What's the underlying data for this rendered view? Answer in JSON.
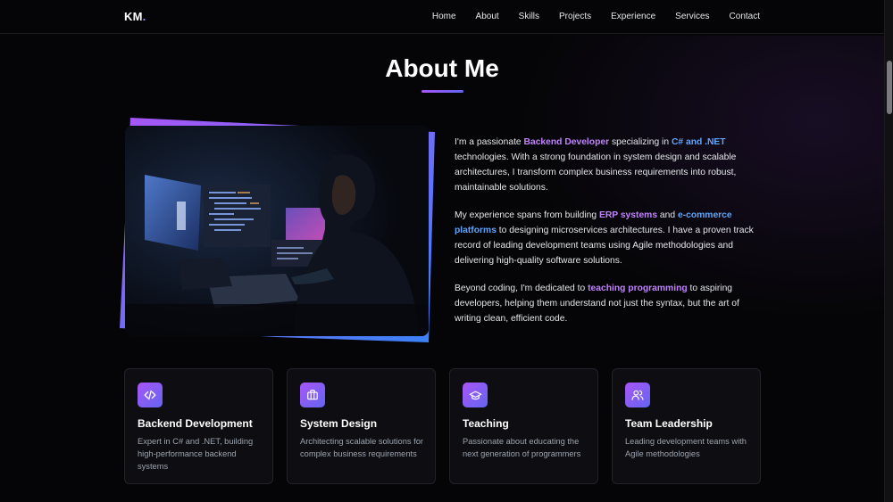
{
  "nav": {
    "logo": "KM",
    "logo_dot": ".",
    "links": [
      "Home",
      "About",
      "Skills",
      "Projects",
      "Experience",
      "Services",
      "Contact"
    ]
  },
  "section": {
    "title": "About Me"
  },
  "about": {
    "p1": {
      "t1": "I'm a passionate ",
      "h1": "Backend Developer",
      "t2": " specializing in ",
      "h2": "C# and .NET",
      "t3": " technologies. With a strong foundation in system design and scalable architectures, I transform complex business requirements into robust, maintainable solutions."
    },
    "p2": {
      "t1": "My experience spans from building ",
      "h1": "ERP systems",
      "t2": " and ",
      "h2": "e-commerce platforms",
      "t3": " to designing microservices architectures. I have a proven track record of leading development teams using Agile methodologies and delivering high-quality software solutions."
    },
    "p3": {
      "t1": "Beyond coding, I'm dedicated to ",
      "h1": "teaching programming",
      "t2": " to aspiring developers, helping them understand not just the syntax, but the art of writing clean, efficient code."
    }
  },
  "cards": [
    {
      "icon": "code-icon",
      "title": "Backend Development",
      "desc": "Expert in C# and .NET, building high-performance backend systems"
    },
    {
      "icon": "briefcase-icon",
      "title": "System Design",
      "desc": "Architecting scalable solutions for complex business requirements"
    },
    {
      "icon": "graduation-cap-icon",
      "title": "Teaching",
      "desc": "Passionate about educating the next generation of programmers"
    },
    {
      "icon": "users-icon",
      "title": "Team Leadership",
      "desc": "Leading development teams with Agile methodologies"
    }
  ],
  "colors": {
    "accent_purple": "#c084fc",
    "accent_blue": "#60a5fa",
    "gradient_start": "#a855f7",
    "gradient_end": "#6366f1",
    "background": "#050507"
  }
}
